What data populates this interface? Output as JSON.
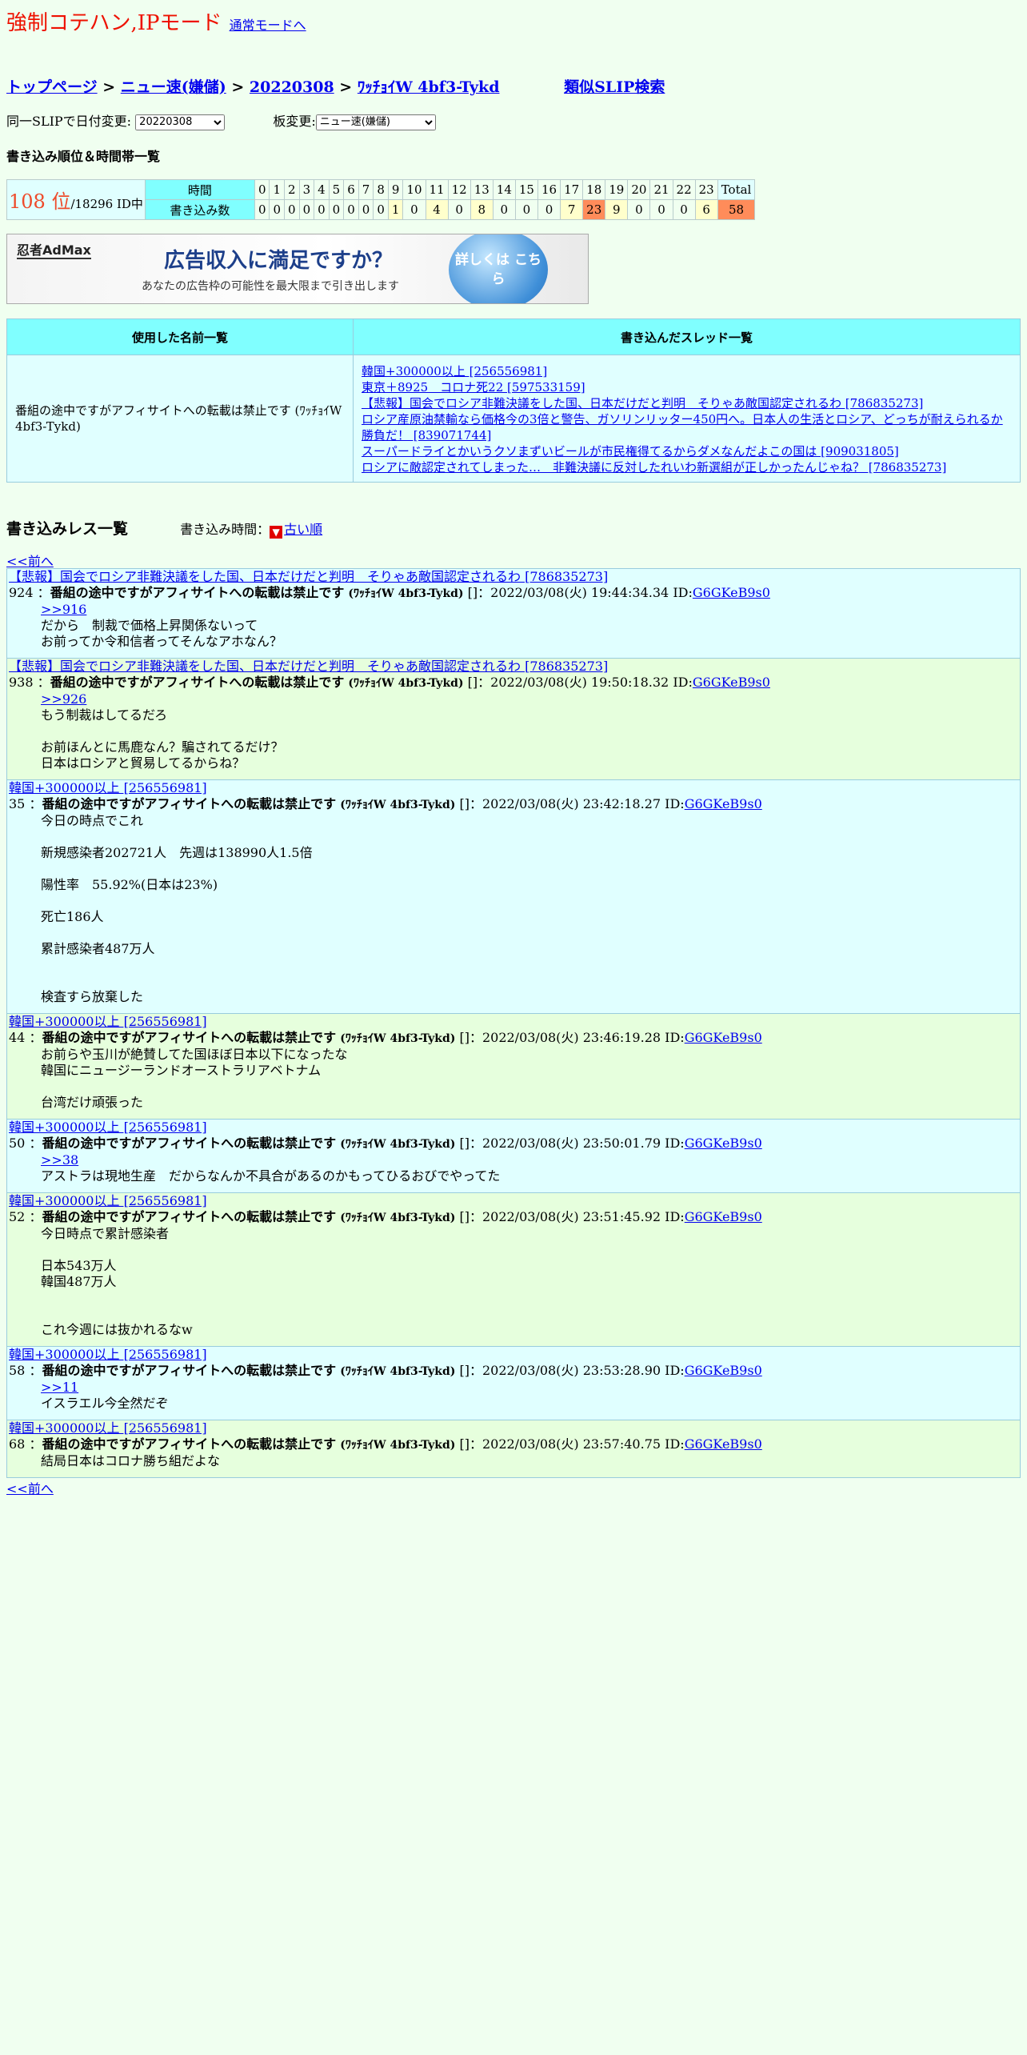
{
  "mode": {
    "title": "強制コテハン,IPモード",
    "link": "通常モードへ"
  },
  "breadcrumb": {
    "top": "トップページ",
    "board": "ニュー速(嫌儲)",
    "date": "20220308",
    "slip": "ﾜｯﾁｮｲW 4bf3-Tykd",
    "similar": "類似SLIP検索"
  },
  "selectors": {
    "date_label": "同一SLIPで日付変更:",
    "date_value": "20220308",
    "board_label": "板変更:",
    "board_value": "ニュー速(嫌儲)"
  },
  "ranking": {
    "heading": "書き込み順位＆時間帯一覧",
    "rank": "108 位",
    "total_ids": "/18296 ID中",
    "row1_label": "時間",
    "row2_label": "書き込み数",
    "hours": [
      "0",
      "1",
      "2",
      "3",
      "4",
      "5",
      "6",
      "7",
      "8",
      "9",
      "10",
      "11",
      "12",
      "13",
      "14",
      "15",
      "16",
      "17",
      "18",
      "19",
      "20",
      "21",
      "22",
      "23"
    ],
    "total_label": "Total",
    "counts": [
      "0",
      "0",
      "0",
      "0",
      "0",
      "0",
      "0",
      "0",
      "0",
      "1",
      "0",
      "4",
      "0",
      "8",
      "0",
      "0",
      "0",
      "7",
      "23",
      "9",
      "0",
      "0",
      "0",
      "6"
    ],
    "total": "58"
  },
  "banner": {
    "brand": "忍者AdMax",
    "headline": "広告収入に満足ですか？",
    "subline": "あなたの広告枠の可能性を最大限まで引き出します",
    "cta": "詳しくは こちら"
  },
  "names_table": {
    "col1": "使用した名前一覧",
    "col2": "書き込んだスレッド一覧",
    "name": "番組の途中ですがアフィサイトへの転載は禁止です (ﾜｯﾁｮｲW 4bf3-Tykd)",
    "threads": [
      "韓国+300000以上 [256556981]",
      "東京＋8925　コロナ死22 [597533159]",
      "【悲報】国会でロシア非難決議をした国、日本だけだと判明　そりゃあ敵国認定されるわ [786835273]",
      "ロシア産原油禁輸なら価格今の3倍と警告、ガソリンリッター450円へ。日本人の生活とロシア、どっちが耐えられるか勝負だ！ [839071744]",
      "スーパードライとかいうクソまずいビールが市民権得てるからダメなんだよこの国は [909031805]",
      "ロシアに敵認定されてしまった…　非難決議に反対したれいわ新選組が正しかったんじゃね？ [786835273]"
    ]
  },
  "posts_section": {
    "heading": "書き込みレス一覧",
    "order_label": "書き込み時間：",
    "order_link": "古い順",
    "prev": "<<前へ"
  },
  "posts": [
    {
      "thread": "【悲報】国会でロシア非難決議をした国、日本だけだと判明　そりゃあ敵国認定されるわ [786835273]",
      "num": "924 ：",
      "name": "番組の途中ですがアフィサイトへの転載は禁止です",
      "trip": "(ﾜｯﾁｮｲW 4bf3-Tykd)",
      "meta": "[]：2022/03/08(火) 19:44:34.34 ID:",
      "id": "G6GKeB9s0",
      "anchor": ">>916",
      "body": "だから　制裁で価格上昇関係ないって\nお前ってか令和信者ってそんなアホなん？"
    },
    {
      "thread": "【悲報】国会でロシア非難決議をした国、日本だけだと判明　そりゃあ敵国認定されるわ [786835273]",
      "num": "938 ：",
      "name": "番組の途中ですがアフィサイトへの転載は禁止です",
      "trip": "(ﾜｯﾁｮｲW 4bf3-Tykd)",
      "meta": "[]：2022/03/08(火) 19:50:18.32 ID:",
      "id": "G6GKeB9s0",
      "anchor": ">>926",
      "body": "もう制裁はしてるだろ\n\nお前ほんとに馬鹿なん？騙されてるだけ？\n日本はロシアと貿易してるからね？"
    },
    {
      "thread": "韓国+300000以上 [256556981]",
      "num": "35 ：",
      "name": "番組の途中ですがアフィサイトへの転載は禁止です",
      "trip": "(ﾜｯﾁｮｲW 4bf3-Tykd)",
      "meta": "[]：2022/03/08(火) 23:42:18.27 ID:",
      "id": "G6GKeB9s0",
      "anchor": "",
      "body": "今日の時点でこれ\n\n新規感染者202721人　先週は138990人1.5倍\n\n陽性率　55.92%(日本は23%)\n\n死亡186人\n\n累計感染者487万人\n\n\n検査すら放棄した"
    },
    {
      "thread": "韓国+300000以上 [256556981]",
      "num": "44 ：",
      "name": "番組の途中ですがアフィサイトへの転載は禁止です",
      "trip": "(ﾜｯﾁｮｲW 4bf3-Tykd)",
      "meta": "[]：2022/03/08(火) 23:46:19.28 ID:",
      "id": "G6GKeB9s0",
      "anchor": "",
      "body": "お前らや玉川が絶賛してた国ほぼ日本以下になったな\n韓国にニュージーランドオーストラリアベトナム\n\n台湾だけ頑張った"
    },
    {
      "thread": "韓国+300000以上 [256556981]",
      "num": "50 ：",
      "name": "番組の途中ですがアフィサイトへの転載は禁止です",
      "trip": "(ﾜｯﾁｮｲW 4bf3-Tykd)",
      "meta": "[]：2022/03/08(火) 23:50:01.79 ID:",
      "id": "G6GKeB9s0",
      "anchor": ">>38",
      "body": "アストラは現地生産　だからなんか不具合があるのかもってひるおびでやってた"
    },
    {
      "thread": "韓国+300000以上 [256556981]",
      "num": "52 ：",
      "name": "番組の途中ですがアフィサイトへの転載は禁止です",
      "trip": "(ﾜｯﾁｮｲW 4bf3-Tykd)",
      "meta": "[]：2022/03/08(火) 23:51:45.92 ID:",
      "id": "G6GKeB9s0",
      "anchor": "",
      "body": "今日時点で累計感染者\n\n日本543万人\n韓国487万人\n\n\nこれ今週には抜かれるなw"
    },
    {
      "thread": "韓国+300000以上 [256556981]",
      "num": "58 ：",
      "name": "番組の途中ですがアフィサイトへの転載は禁止です",
      "trip": "(ﾜｯﾁｮｲW 4bf3-Tykd)",
      "meta": "[]：2022/03/08(火) 23:53:28.90 ID:",
      "id": "G6GKeB9s0",
      "anchor": ">>11",
      "body": "イスラエル今全然だぞ"
    },
    {
      "thread": "韓国+300000以上 [256556981]",
      "num": "68 ：",
      "name": "番組の途中ですがアフィサイトへの転載は禁止です",
      "trip": "(ﾜｯﾁｮｲW 4bf3-Tykd)",
      "meta": "[]：2022/03/08(火) 23:57:40.75 ID:",
      "id": "G6GKeB9s0",
      "anchor": "",
      "body": "結局日本はコロナ勝ち組だよな"
    }
  ]
}
